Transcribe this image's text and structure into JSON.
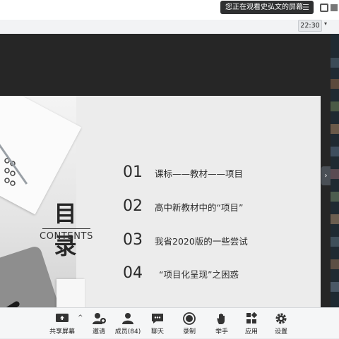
{
  "banner": {
    "text": "您正在观看史弘文的屏幕",
    "menu_glyph": "☰"
  },
  "clock": {
    "time": "22:30"
  },
  "slide": {
    "title": "目 录",
    "subtitle": "CONTENTS",
    "items": [
      {
        "num": "01",
        "text": "课标——教材——项目"
      },
      {
        "num": "02",
        "text": "高中新教材中的“项目”"
      },
      {
        "num": "03",
        "text": "我省2020版的一些尝试"
      },
      {
        "num": "04",
        "text": "“项目化呈现”之困惑"
      }
    ]
  },
  "toolbar": {
    "share_screen": "共享屏幕",
    "invite": "邀请",
    "members": "成员(84)",
    "chat": "聊天",
    "record": "录制",
    "raise_hand": "举手",
    "apps": "应用",
    "settings": "设置"
  },
  "colors": {
    "stage": "#262626",
    "slide_bg": "#ececec",
    "toolbar_bg": "#f5f6f7"
  }
}
